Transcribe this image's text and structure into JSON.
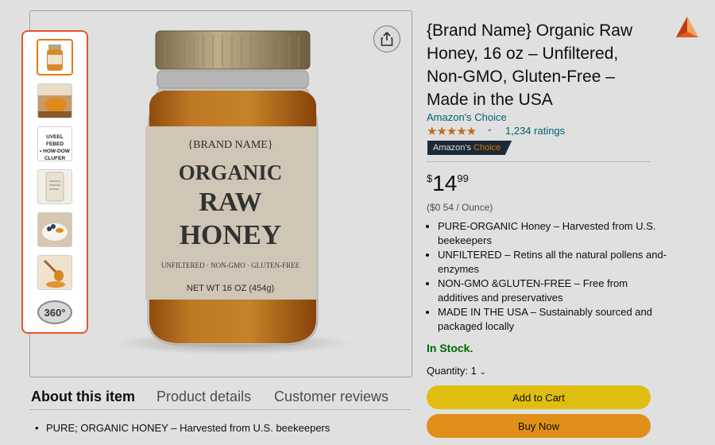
{
  "product": {
    "title": "{Brand Name} Organic Raw Honey, 16 oz – Unfiltered, Non-GMO, Gluten-Free – Made in the USA",
    "choice_link": "Amazon's Choice",
    "stars_glyph": "★★★★★",
    "ratings_text": "1,234 ratings",
    "badge_prefix": "Amazon's",
    "badge_highlight": "Choice",
    "price_symbol": "$",
    "price_whole": "14",
    "price_fraction": "99",
    "unit_price": "($0 54 / Ounce)",
    "bullets": [
      "PURE-ORGANIC Honey – Harvested from U.S. beekeepers",
      "UNFILTERED – Retins all the natural pollens and-enzymes",
      "NON-GMO &GLUTEN-FREE – Free from additives and preservatives",
      "MADE IN THE USA – Sustainably sourced and packaged locally"
    ],
    "stock": "In Stock.",
    "quantity_label": "Quantity: 1",
    "add_to_cart": "Add to Cart",
    "buy_now": "Buy Now"
  },
  "jar_label": {
    "brand": "{BRAND NAME}",
    "line1": "ORGANIC",
    "line2": "RAW",
    "line3": "HONEY",
    "features": "UNFILTERED · NON-GMO · GLUTEN-FREE",
    "net_weight": "NET WT 16 OZ (454g)"
  },
  "thumbnails": {
    "text_thumb": "UVEEL FEBED\n• HOW-DOW\nCLUFER FREE",
    "btn_360": "360°"
  },
  "tabs": {
    "about": "About this item",
    "details": "Product details",
    "reviews": "Customer reviews"
  },
  "about_bullet": "PURE; ORGANIC HONEY – Harvested from U.S. beekeepers",
  "colors": {
    "accent_orange": "#e2572b",
    "link": "#007185",
    "in_stock": "#007600",
    "cart_button": "#ffd814",
    "buy_button": "#ffa41c",
    "star": "#de7921"
  },
  "icons": {
    "share": "share-icon",
    "chevron": "chevron-down-icon",
    "logo": "pyramid-logo-icon"
  }
}
